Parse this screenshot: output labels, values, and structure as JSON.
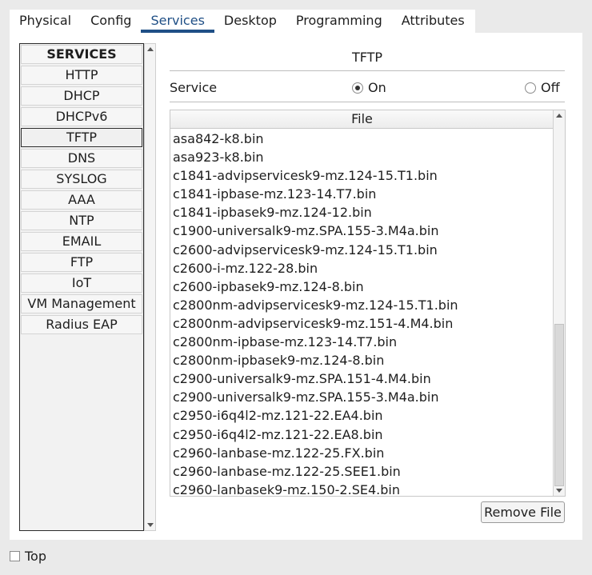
{
  "tabs": [
    "Physical",
    "Config",
    "Services",
    "Desktop",
    "Programming",
    "Attributes"
  ],
  "active_tab": "Services",
  "services_header": "SERVICES",
  "services": [
    "HTTP",
    "DHCP",
    "DHCPv6",
    "TFTP",
    "DNS",
    "SYSLOG",
    "AAA",
    "NTP",
    "EMAIL",
    "FTP",
    "IoT",
    "VM Management",
    "Radius EAP"
  ],
  "selected_service": "TFTP",
  "panel_title": "TFTP",
  "service_label": "Service",
  "radio_on": "On",
  "radio_off": "Off",
  "radio_selected": "On",
  "file_column_header": "File",
  "files": [
    "asa842-k8.bin",
    "asa923-k8.bin",
    "c1841-advipservicesk9-mz.124-15.T1.bin",
    "c1841-ipbase-mz.123-14.T7.bin",
    "c1841-ipbasek9-mz.124-12.bin",
    "c1900-universalk9-mz.SPA.155-3.M4a.bin",
    "c2600-advipservicesk9-mz.124-15.T1.bin",
    "c2600-i-mz.122-28.bin",
    "c2600-ipbasek9-mz.124-8.bin",
    "c2800nm-advipservicesk9-mz.124-15.T1.bin",
    "c2800nm-advipservicesk9-mz.151-4.M4.bin",
    "c2800nm-ipbase-mz.123-14.T7.bin",
    "c2800nm-ipbasek9-mz.124-8.bin",
    "c2900-universalk9-mz.SPA.151-4.M4.bin",
    "c2900-universalk9-mz.SPA.155-3.M4a.bin",
    "c2950-i6q4l2-mz.121-22.EA4.bin",
    "c2950-i6q4l2-mz.121-22.EA8.bin",
    "c2960-lanbase-mz.122-25.FX.bin",
    "c2960-lanbase-mz.122-25.SEE1.bin",
    "c2960-lanbasek9-mz.150-2.SE4.bin"
  ],
  "remove_button": "Remove File",
  "top_checkbox_label": "Top",
  "top_checked": false,
  "colors": {
    "active_tab": "#1f4f86",
    "background": "#eaeaea",
    "panel": "#ffffff"
  }
}
